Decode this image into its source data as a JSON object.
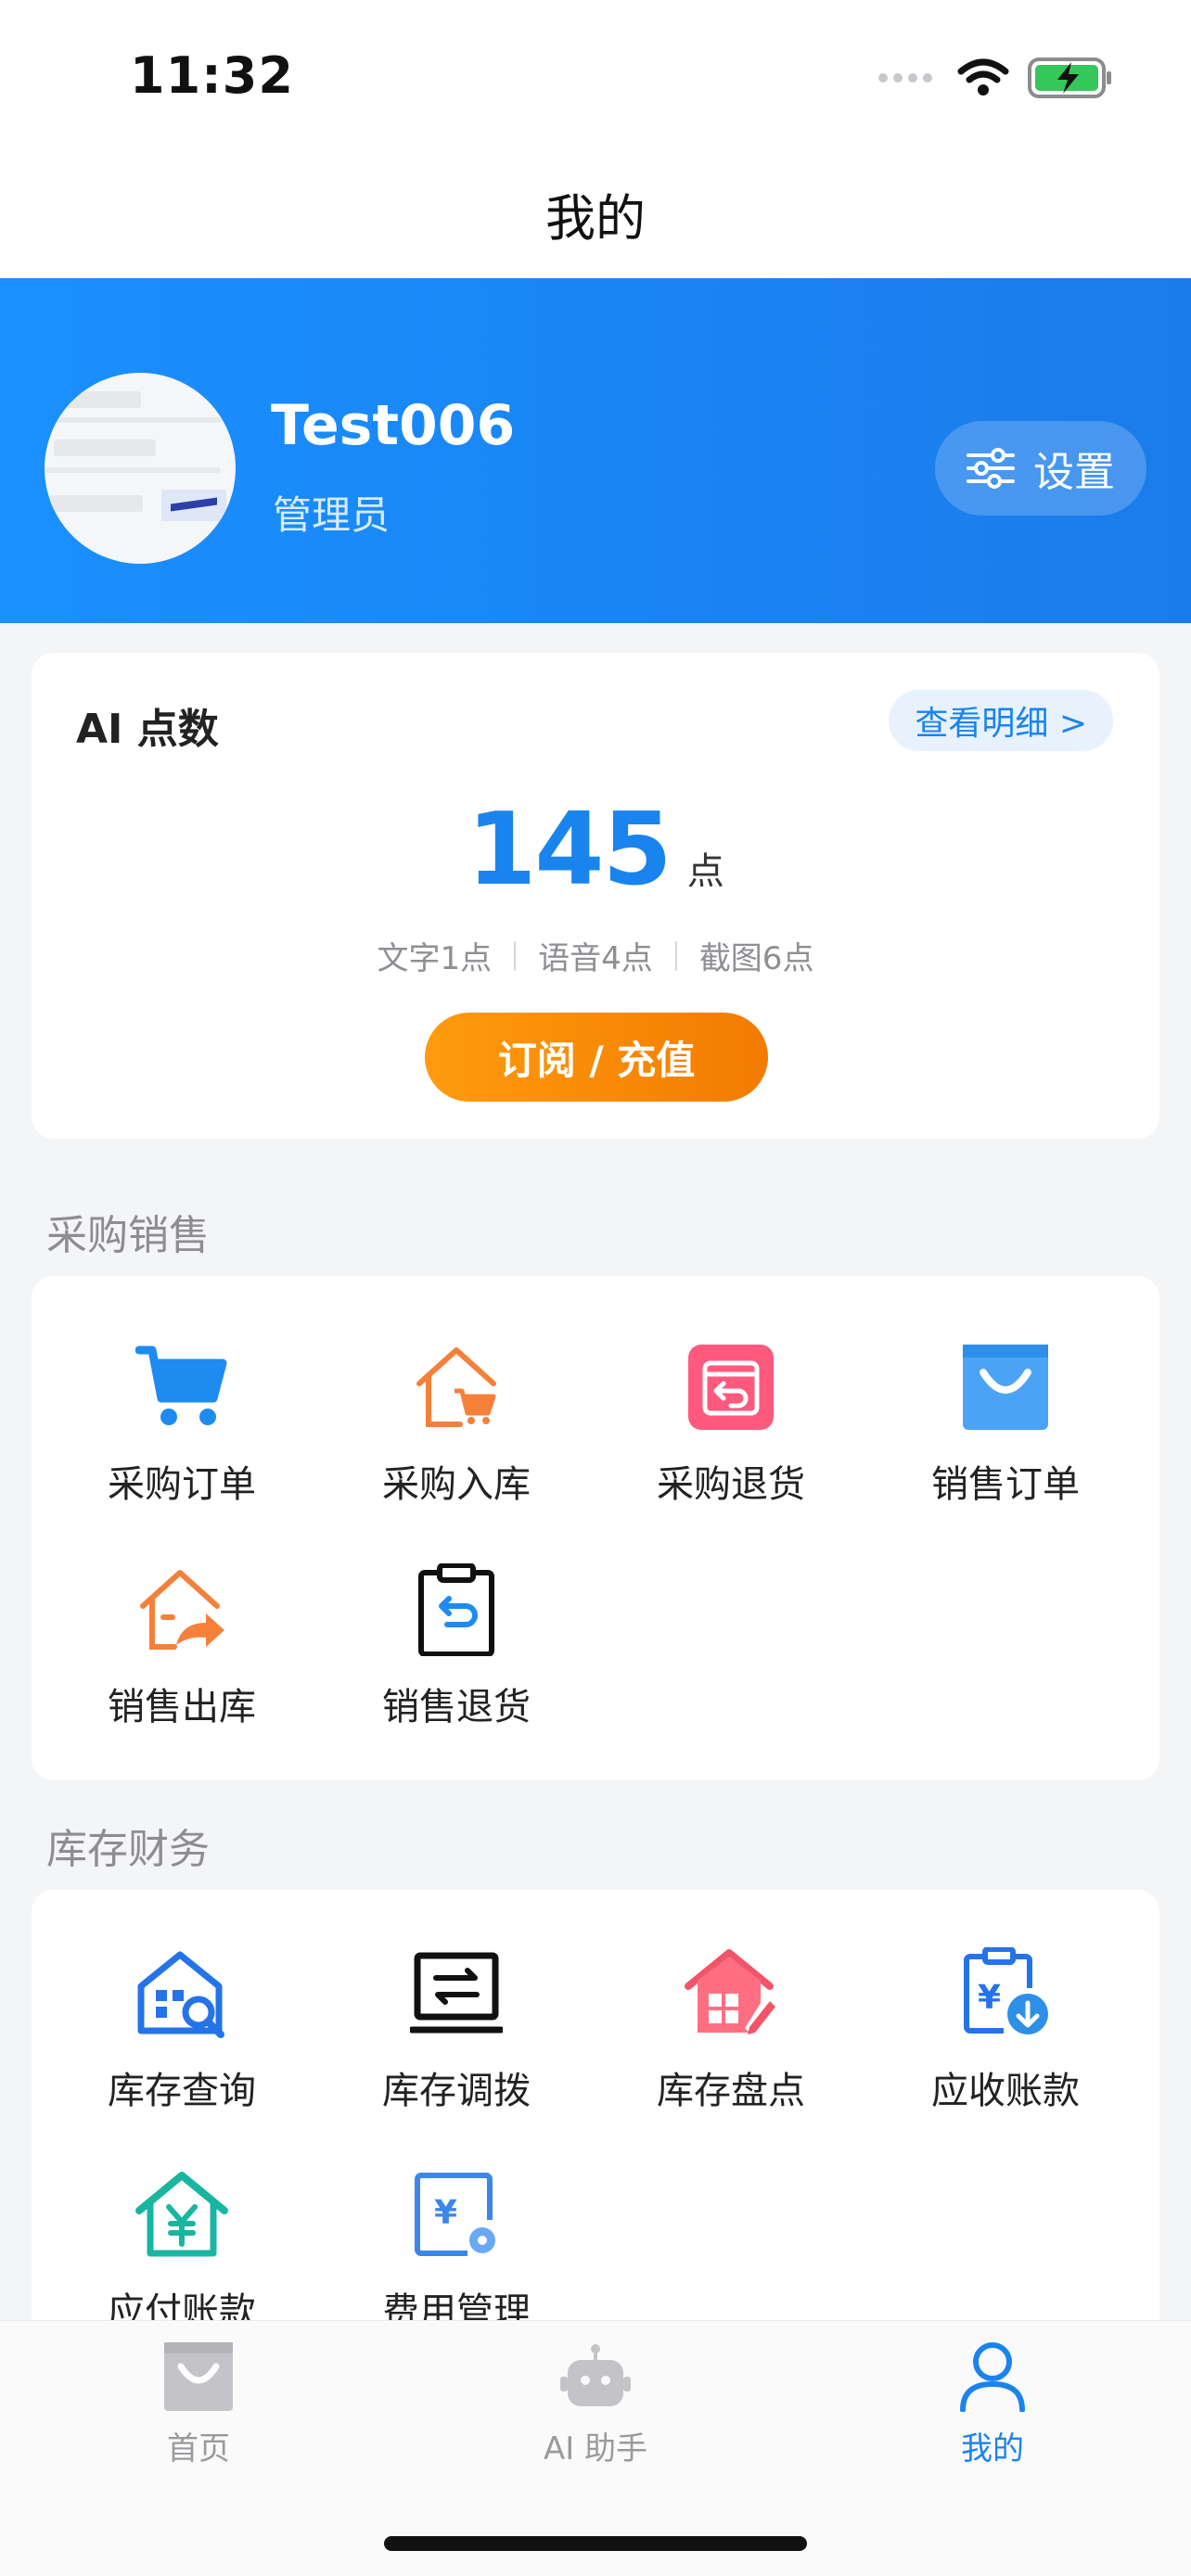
{
  "status": {
    "time": "11:32"
  },
  "nav": {
    "title": "我的"
  },
  "profile": {
    "username": "Test006",
    "role": "管理员",
    "settings_label": "设置"
  },
  "ai_points": {
    "title": "AI 点数",
    "detail_label": "查看明细 >",
    "value": "145",
    "unit": "点",
    "rates": [
      "文字1点",
      "语音4点",
      "截图6点"
    ],
    "recharge_label": "订阅 / 充值"
  },
  "sections": {
    "purchase_sales": {
      "title": "采购销售",
      "items": [
        "采购订单",
        "采购入库",
        "采购退货",
        "销售订单",
        "销售出库",
        "销售退货"
      ]
    },
    "inventory_finance": {
      "title": "库存财务",
      "items": [
        "库存查询",
        "库存调拨",
        "库存盘点",
        "应收账款",
        "应付账款",
        "费用管理"
      ]
    }
  },
  "tabs": [
    "首页",
    "AI 助手",
    "我的"
  ],
  "colors": {
    "primary": "#1a84ee",
    "accent_orange": "#f7860a",
    "header_blue": "#1a8aff"
  }
}
